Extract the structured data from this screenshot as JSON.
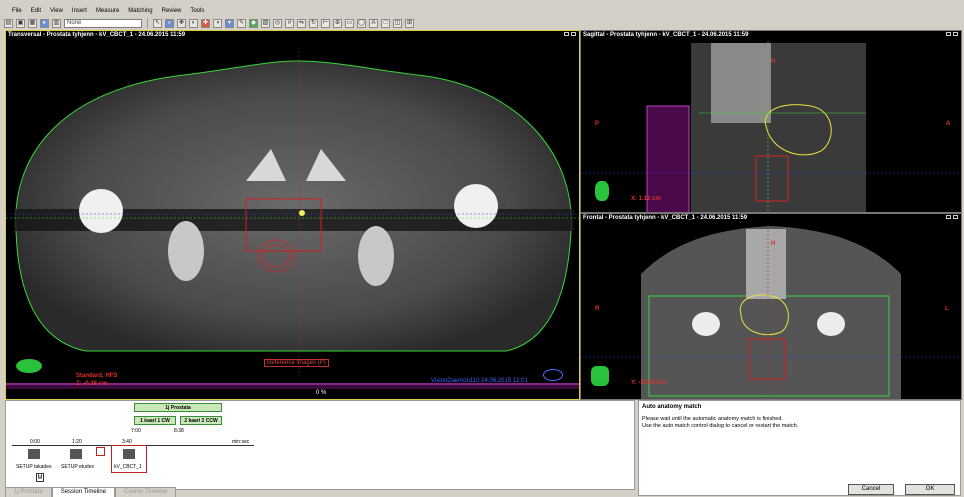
{
  "menu": [
    "File",
    "Edit",
    "View",
    "Insert",
    "Measure",
    "Matching",
    "Review",
    "Tools"
  ],
  "toolbar": {
    "combo_value": "None"
  },
  "transversal": {
    "title": "Transversal - Prostata tyhjenn - kV_CBCT_1 - 24.06.2015 11:59",
    "orientation": "Standard, HFS",
    "coord": "Z: -0.48 cm",
    "reference_label": "Reference Images (P)",
    "footer": "VisionDaemon110  24.06.2015 12:01",
    "zoom": "0 %"
  },
  "sagittal": {
    "title": "Sagittal - Prostata tyhjenn - kV_CBCT_1 - 24.06.2015 11:59",
    "label_left": "P",
    "label_right": "A",
    "label_top": "H",
    "coord": "X: 1.12 cm"
  },
  "frontal": {
    "title": "Frontal - Prostata tyhjenn - kV_CBCT_1 - 24.06.2015 11:59",
    "label_left": "R",
    "label_right": "L",
    "label_top": "H",
    "coord": "Y: -33.90 cm"
  },
  "timeline": {
    "fraction": "1j Prostata",
    "arc1": "1 kaari 1 CW",
    "arc2": "2 kaari 2 CCW",
    "t0": "0:00",
    "t1": "1:20",
    "t2": "3:40",
    "t3": "7:00",
    "t4": "8:38",
    "unit": "min:sec",
    "item1": "SETUP takadex",
    "item2": "SETUP etudex",
    "item3": "kV_CBCT_1"
  },
  "tabs": [
    "1j Prostata",
    "Session Timeline",
    "Course Timeline"
  ],
  "message": {
    "title": "Auto anatomy match",
    "line1": "Please wait until the automatic anatomy match is finished.",
    "line2": "Use the auto match control dialog to cancel or restart the match."
  },
  "buttons": {
    "cancel": "Cancel",
    "ok": "OK"
  },
  "colors": {
    "contour_green": "#39d639",
    "contour_yellow": "#e8e040",
    "roi_red": "#d02020",
    "accent_blue": "#3050ff"
  }
}
